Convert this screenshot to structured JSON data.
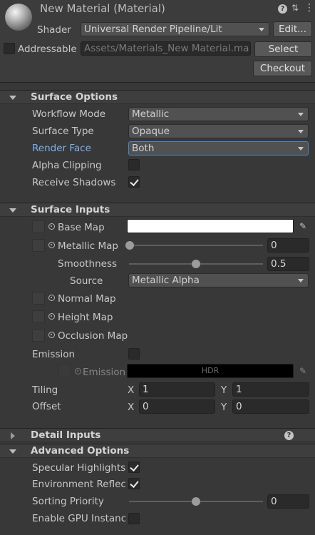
{
  "header": {
    "title": "New Material (Material)",
    "shader_label": "Shader",
    "shader_value": "Universal Render Pipeline/Lit",
    "edit_button": "Edit...",
    "addressable_label": "Addressable",
    "addressable_checked": false,
    "asset_path": "Assets/Materials_New Material.ma",
    "select_button": "Select",
    "checkout_button": "Checkout",
    "icons": [
      "help-icon",
      "preset-icon",
      "menu-icon"
    ]
  },
  "surface_options": {
    "title": "Surface Options",
    "expanded": true,
    "rows": [
      {
        "label": "Workflow Mode",
        "value": "Metallic"
      },
      {
        "label": "Surface Type",
        "value": "Opaque"
      },
      {
        "label": "Render Face",
        "value": "Both",
        "highlight_color": "#7bb2f0"
      }
    ],
    "alpha_clipping": {
      "label": "Alpha Clipping",
      "checked": false
    },
    "receive_shadows": {
      "label": "Receive Shadows",
      "checked": true
    }
  },
  "surface_inputs": {
    "title": "Surface Inputs",
    "expanded": true,
    "base_map": {
      "label": "Base Map",
      "color": "#ffffff"
    },
    "metallic_map": {
      "label": "Metallic Map",
      "value": "0",
      "slider": 0
    },
    "smoothness": {
      "label": "Smoothness",
      "value": "0.5",
      "slider": 0.5
    },
    "source": {
      "label": "Source",
      "value": "Metallic Alpha"
    },
    "normal_map": {
      "label": "Normal Map"
    },
    "height_map": {
      "label": "Height Map"
    },
    "occlusion_map": {
      "label": "Occlusion Map"
    },
    "emission": {
      "label": "Emission",
      "checked": false,
      "sub_label": "Emission",
      "hdr_label": "HDR"
    },
    "tiling": {
      "label": "Tiling",
      "x_label": "X",
      "x": "1",
      "y_label": "Y",
      "y": "1"
    },
    "offset": {
      "label": "Offset",
      "x_label": "X",
      "x": "0",
      "y_label": "Y",
      "y": "0"
    }
  },
  "detail_inputs": {
    "title": "Detail Inputs",
    "expanded": false
  },
  "advanced_options": {
    "title": "Advanced Options",
    "expanded": true,
    "specular_highlights": {
      "label": "Specular Highlights",
      "checked": true
    },
    "environment_reflections": {
      "label": "Environment Reflec",
      "checked": true
    },
    "sorting_priority": {
      "label": "Sorting Priority",
      "value": "0",
      "slider": 0.5
    },
    "gpu_instancing": {
      "label": "Enable GPU Instanc",
      "checked": false
    }
  }
}
